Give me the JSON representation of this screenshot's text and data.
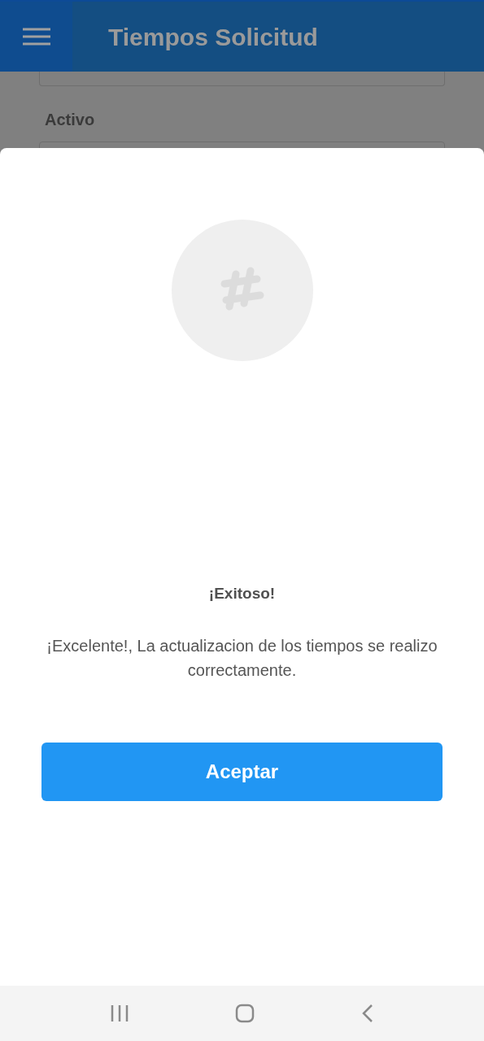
{
  "app_bar": {
    "title": "Tiempos Solicitud"
  },
  "form": {
    "label": "Activo"
  },
  "dialog": {
    "title": "¡Exitoso!",
    "message": "¡Excelente!, La actualizacion de los tiempos se realizo correctamente.",
    "button": "Aceptar"
  }
}
